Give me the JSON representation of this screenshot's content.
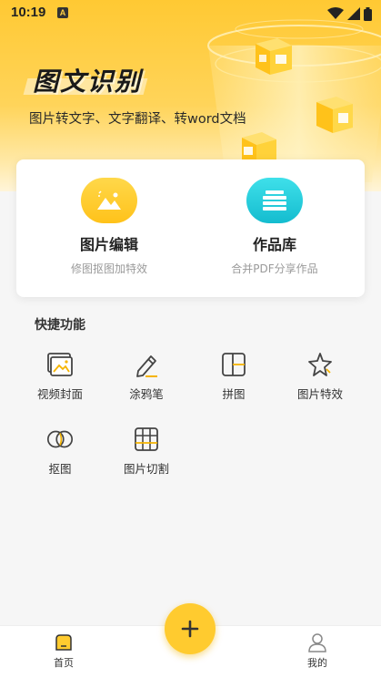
{
  "status_bar": {
    "time": "10:19",
    "badge": "A"
  },
  "header": {
    "title": "图文识别",
    "subtitle": "图片转文字、文字翻译、转word文档"
  },
  "features": [
    {
      "title": "图片编辑",
      "subtitle": "修图抠图加特效",
      "icon": "image-edit-icon",
      "color": "#ffcb2f"
    },
    {
      "title": "作品库",
      "subtitle": "合并PDF分享作品",
      "icon": "stack-icon",
      "color": "#1ec9d8"
    }
  ],
  "quick": {
    "title": "快捷功能",
    "tools": [
      {
        "label": "视频封面",
        "icon": "video-cover-icon"
      },
      {
        "label": "涂鸦笔",
        "icon": "pencil-icon"
      },
      {
        "label": "拼图",
        "icon": "collage-icon"
      },
      {
        "label": "图片特效",
        "icon": "star-effect-icon"
      },
      {
        "label": "抠图",
        "icon": "cutout-icon"
      },
      {
        "label": "图片切割",
        "icon": "grid-cut-icon"
      }
    ]
  },
  "nav": {
    "home": "首页",
    "mine": "我的"
  },
  "colors": {
    "accent": "#ffcb2f",
    "teal": "#1ec9d8"
  }
}
